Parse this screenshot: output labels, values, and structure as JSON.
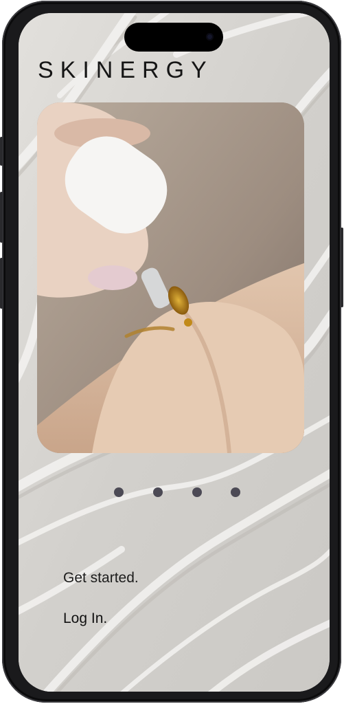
{
  "app": {
    "brand": "SKINERGY"
  },
  "hero_image": {
    "alt": "",
    "subject": "dropper applying serum oil to hand"
  },
  "pagination": {
    "total": 4,
    "color": "#4c4a55"
  },
  "actions": {
    "get_started_label": "Get started.",
    "login_label": "Log In."
  },
  "device": {
    "icons": [
      "front-camera-icon"
    ]
  }
}
